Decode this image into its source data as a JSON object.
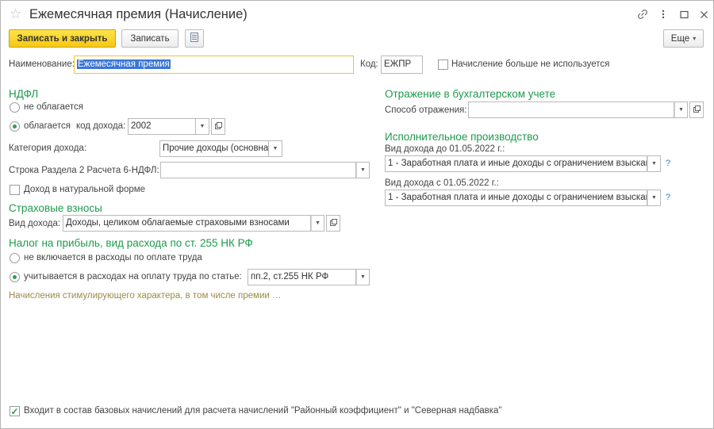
{
  "window": {
    "title": "Ежемесячная премия (Начисление)"
  },
  "toolbar": {
    "save_close_label": "Записать и закрыть",
    "save_label": "Записать",
    "more_label": "Еще",
    "more_arrow": "▾"
  },
  "form": {
    "name_label": "Наименование:",
    "name_value": "Ежемесячная премия",
    "code_label": "Код:",
    "code_value": "ЕЖПР",
    "not_used_label": "Начисление больше не используется",
    "not_used_checked": false
  },
  "ndfl": {
    "section_title": "НДФЛ",
    "not_taxed_label": "не облагается",
    "taxed_label": "облагается",
    "income_code_label": "код дохода:",
    "income_code_value": "2002",
    "category_label": "Категория дохода:",
    "category_value": "Прочие доходы (основная",
    "row6_label": "Строка Раздела 2 Расчета 6-НДФЛ:",
    "row6_value": "",
    "in_kind_label": "Доход в натуральной форме",
    "in_kind_checked": false,
    "selected": "taxed"
  },
  "insurance": {
    "section_title": "Страховые взносы",
    "income_type_label": "Вид дохода:",
    "income_type_value": "Доходы, целиком облагаемые страховыми взносами"
  },
  "profit_tax": {
    "section_title": "Налог на прибыль, вид расхода по ст. 255 НК РФ",
    "not_included_label": "не включается в расходы по оплате труда",
    "included_label": "учитывается в расходах на оплату труда по статье:",
    "article_value": "пп.2, ст.255 НК РФ",
    "selected": "included",
    "note": "Начисления стимулирующего характера, в том числе премии …"
  },
  "accounting": {
    "section_title": "Отражение в бухгалтерском учете",
    "method_label": "Способ отражения:",
    "method_value": ""
  },
  "enforcement": {
    "section_title": "Исполнительное производство",
    "before_label": "Вид дохода до 01.05.2022 г.:",
    "before_value": "1 - Заработная плата и иные доходы с ограничением взыскани",
    "after_label": "Вид дохода с 01.05.2022 г.:",
    "after_value": "1 - Заработная плата и иные доходы с ограничением взыскани",
    "help_mark": "?"
  },
  "footer": {
    "base_accruals_label": "Входит в состав базовых начислений для расчета начислений \"Районный коэффициент\" и \"Северная надбавка\"",
    "base_accruals_checked": true
  },
  "icons": {
    "star": "star-icon",
    "link": "link-icon",
    "menu": "more-vertical-icon",
    "maximize": "maximize-icon",
    "close": "close-icon",
    "dropdown": "chevron-down-icon",
    "open": "open-form-icon"
  },
  "colors": {
    "accent_green": "#1d9b4c",
    "primary_button": "#f6c814",
    "help_blue": "#2f7fd0",
    "note_text": "#9b8a4a"
  }
}
